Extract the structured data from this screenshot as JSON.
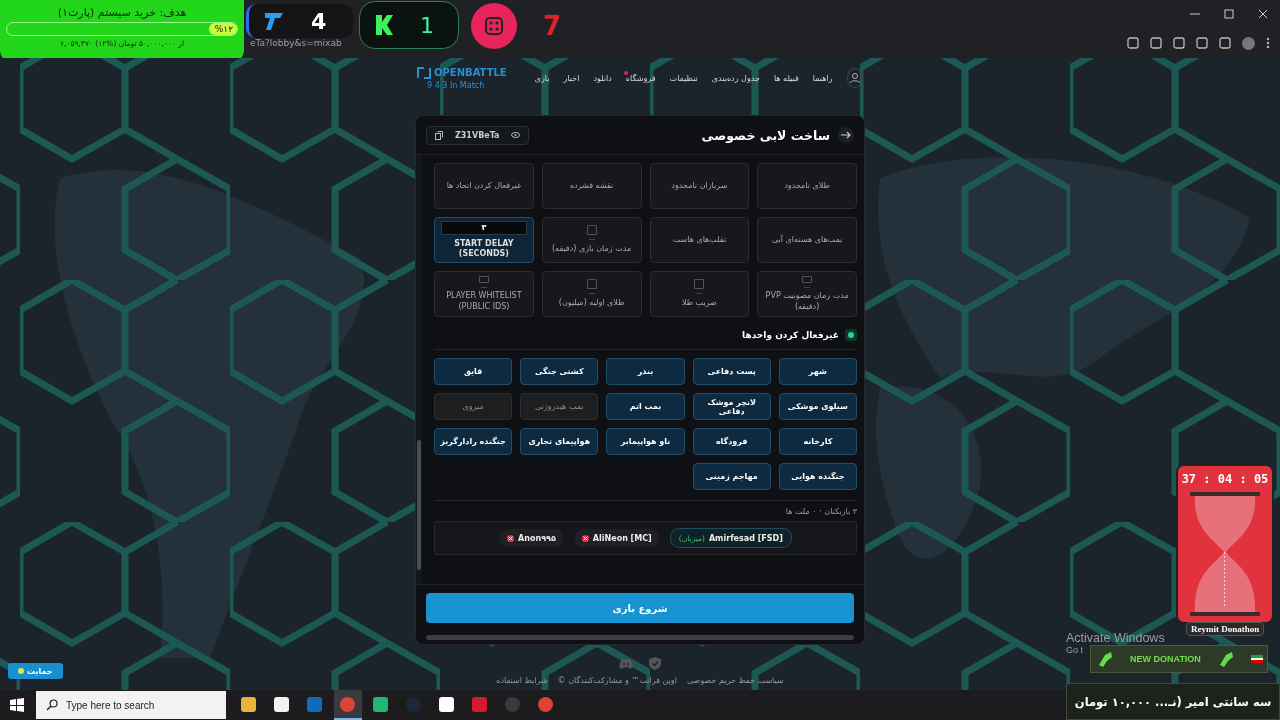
{
  "browser": {
    "address_fragment": "eTa?lobby&s=mixab"
  },
  "stream_overlay": {
    "goal": {
      "title": "هدف: خرید سیستم (پارت۱)",
      "level": 0.12,
      "percent": "%۱۲",
      "amount": "۶,۰۵۹,۳۷۰ از ۵۰,۰۰۰,۰۰۰ تومان (%۱۲)"
    },
    "t_counter": "4",
    "k_counter": "1",
    "dice_counter": "7",
    "timer": "37 : 04 : 05",
    "timer_label": "Reymit Donathon",
    "donation_title": "NEW DONATION",
    "donation_message": "سه سانتی امیر (نـ... ۱۰,۰۰۰ تومان"
  },
  "site": {
    "logo": "OPENBATTLE",
    "status": "9 4 3 In Match",
    "nav": [
      {
        "label": "راهنما",
        "badge": false
      },
      {
        "label": "قبیله ها",
        "badge": false
      },
      {
        "label": "جدول رده‌بندی",
        "badge": false
      },
      {
        "label": "تنظیمات",
        "badge": false
      },
      {
        "label": "فروشگاه",
        "badge": true
      },
      {
        "label": "دانلود",
        "badge": false
      },
      {
        "label": "اخبار",
        "badge": false
      },
      {
        "label": "بازی",
        "badge": false
      }
    ]
  },
  "lobby": {
    "title": "ساخت لابی خصوصی",
    "code": "Z31VBeTa",
    "settings": [
      {
        "kind": "toggle",
        "label": "طلای نامحدود",
        "on": false
      },
      {
        "kind": "toggle",
        "label": "سربازان نامحدود",
        "on": false
      },
      {
        "kind": "toggle",
        "label": "نقشه فشرده",
        "on": false
      },
      {
        "kind": "toggle",
        "label": "غیرفعال کردن اتحاد ها",
        "on": false
      },
      {
        "kind": "toggle",
        "label": "بمب‌های هسته‌ای آبی",
        "on": false
      },
      {
        "kind": "toggle",
        "label": "تقلب‌های هاست",
        "on": false
      },
      {
        "kind": "checkbox",
        "label": "مدت زمان بازی (دقیقه)",
        "checked": false,
        "on": false
      },
      {
        "kind": "number",
        "label": "START DELAY (SECONDS)",
        "value": "۳",
        "on": true
      },
      {
        "kind": "checkbox",
        "label": "مدت زمان مصونیت PVP (دقیقه)",
        "checked": false,
        "on": false
      },
      {
        "kind": "checkbox",
        "label": "ضریب طلا",
        "checked": false,
        "on": false
      },
      {
        "kind": "checkbox",
        "label": "طلای اولیه (میلیون)",
        "checked": false,
        "on": false
      },
      {
        "kind": "checkbox",
        "label": "PLAYER WHITELIST (PUBLIC IDS)",
        "checked": false,
        "on": false
      }
    ],
    "units_title": "غیرفعال کردن واحدها",
    "units": [
      {
        "label": "شهر",
        "enabled": true
      },
      {
        "label": "پست دفاعی",
        "enabled": true
      },
      {
        "label": "بندر",
        "enabled": true
      },
      {
        "label": "کشتی جنگی",
        "enabled": true
      },
      {
        "label": "قایق",
        "enabled": true
      },
      {
        "label": "سیلوی موشکی",
        "enabled": true
      },
      {
        "label": "لانچر موشک دفاعی",
        "enabled": true
      },
      {
        "label": "بمب اتم",
        "enabled": true
      },
      {
        "label": "بمب هیدروژنی",
        "enabled": false
      },
      {
        "label": "میروی",
        "enabled": false
      },
      {
        "label": "کارخانه",
        "enabled": true
      },
      {
        "label": "فرودگاه",
        "enabled": true
      },
      {
        "label": "ناو هواپیمابر",
        "enabled": true
      },
      {
        "label": "هواپیمای تجاری",
        "enabled": true
      },
      {
        "label": "جنگنده رادارگریز",
        "enabled": true
      },
      {
        "label": "جنگنده هوایی",
        "enabled": true
      },
      {
        "label": "مهاجم زمینی",
        "enabled": true
      }
    ],
    "players_summary": "۳ بازیکنان  ·  ۰ ملت ها",
    "players": [
      {
        "kind": "host",
        "name": "Amirfesad [FSD]",
        "tag": "(میزبان)"
      },
      {
        "kind": "player",
        "name": "AliNeon [MC]"
      },
      {
        "kind": "player",
        "name": "Anon۹۹۵"
      }
    ],
    "start_button": "شروع بازی"
  },
  "footer": {
    "links": [
      "سیاست حفظ حریم خصوصی",
      "اوپن فرانت™ و مشارکت‌کنندگان ©",
      "شرایط استفاده"
    ],
    "support_button": "حمایت"
  },
  "windows": {
    "watermark_title": "Activate Windows",
    "watermark_sub": "Go t",
    "search_placeholder": "Type here to search",
    "taskbar_apps": [
      {
        "kind": "folder",
        "selected": false
      },
      {
        "kind": "store",
        "selected": false
      },
      {
        "kind": "mail",
        "selected": false
      },
      {
        "kind": "browser",
        "selected": true
      },
      {
        "kind": "shield",
        "selected": false
      },
      {
        "kind": "steam",
        "selected": false
      },
      {
        "kind": "ring",
        "selected": false
      },
      {
        "kind": "red",
        "selected": false
      },
      {
        "kind": "record",
        "selected": false
      },
      {
        "kind": "browser",
        "selected": false
      }
    ]
  }
}
